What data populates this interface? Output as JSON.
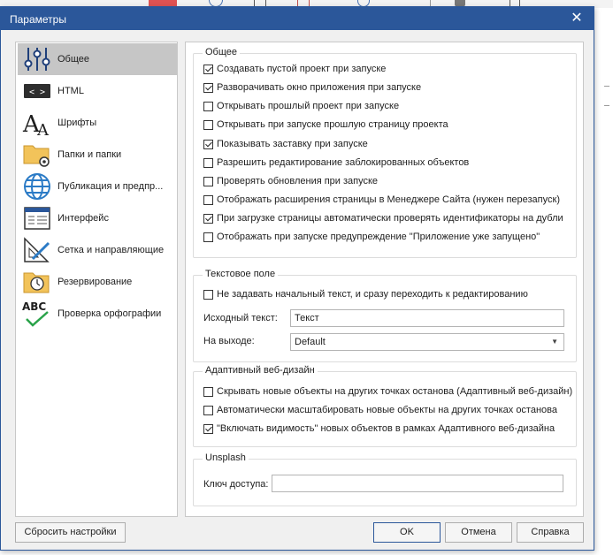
{
  "window": {
    "title": "Параметры",
    "close_glyph": "✕"
  },
  "nav": {
    "items": [
      {
        "label": "Общее",
        "icon": "sliders-icon",
        "selected": true
      },
      {
        "label": "HTML",
        "icon": "code-icon"
      },
      {
        "label": "Шрифты",
        "icon": "font-icon"
      },
      {
        "label": "Папки и папки",
        "icon": "folder-gear-icon"
      },
      {
        "label": "Публикация и предпр...",
        "icon": "globe-icon"
      },
      {
        "label": "Интерфейс",
        "icon": "window-layout-icon"
      },
      {
        "label": "Сетка и направляющие",
        "icon": "ruler-triangle-icon"
      },
      {
        "label": "Резервирование",
        "icon": "folder-clock-icon"
      },
      {
        "label": "Проверка орфографии",
        "icon": "spellcheck-icon"
      }
    ]
  },
  "general": {
    "title": "Общее",
    "options": [
      {
        "label": "Создавать пустой проект при запуске",
        "checked": true
      },
      {
        "label": "Разворачивать окно приложения при запуске",
        "checked": true
      },
      {
        "label": "Открывать прошлый проект при запуске",
        "checked": false
      },
      {
        "label": "Открывать при запуске прошлую страницу проекта",
        "checked": false
      },
      {
        "label": "Показывать заставку при запуске",
        "checked": true
      },
      {
        "label": "Разрешить редактирование заблокированных объектов",
        "checked": false
      },
      {
        "label": "Проверять обновления при запуске",
        "checked": false
      },
      {
        "label": "Отображать расширения страницы в Менеджере Сайта (нужен перезапуск)",
        "checked": false
      },
      {
        "label": "При загрузке страницы автоматически проверять идентификаторы на дубли",
        "checked": true
      },
      {
        "label": "Отображать при запуске предупреждение \"Приложение уже запущено\"",
        "checked": false
      }
    ]
  },
  "text_field": {
    "title": "Текстовое поле",
    "option": {
      "label": "Не задавать начальный текст, и сразу переходить к редактированию",
      "checked": false
    },
    "source_label": "Исходный текст:",
    "source_value": "Текст",
    "output_label": "На выходе:",
    "output_value": "Default"
  },
  "adaptive": {
    "title": "Адаптивный веб-дизайн",
    "options": [
      {
        "label": "Скрывать новые объекты на других точках останова (Адаптивный веб-дизайн)",
        "checked": false
      },
      {
        "label": "Автоматически масштабировать новые объекты на других точках останова",
        "checked": false
      },
      {
        "label": "\"Включать видимость\" новых объектов в рамках Адаптивного веб-дизайна",
        "checked": true
      }
    ]
  },
  "unsplash": {
    "title": "Unsplash",
    "key_label": "Ключ доступа:",
    "key_value": ""
  },
  "buttons": {
    "reset": "Сбросить настройки",
    "ok": "OK",
    "cancel": "Отмена",
    "help": "Справка"
  },
  "colors": {
    "accent": "#2b579a",
    "selected_nav": "#c6c6c6",
    "dialog_bg": "#f0f0f0"
  }
}
